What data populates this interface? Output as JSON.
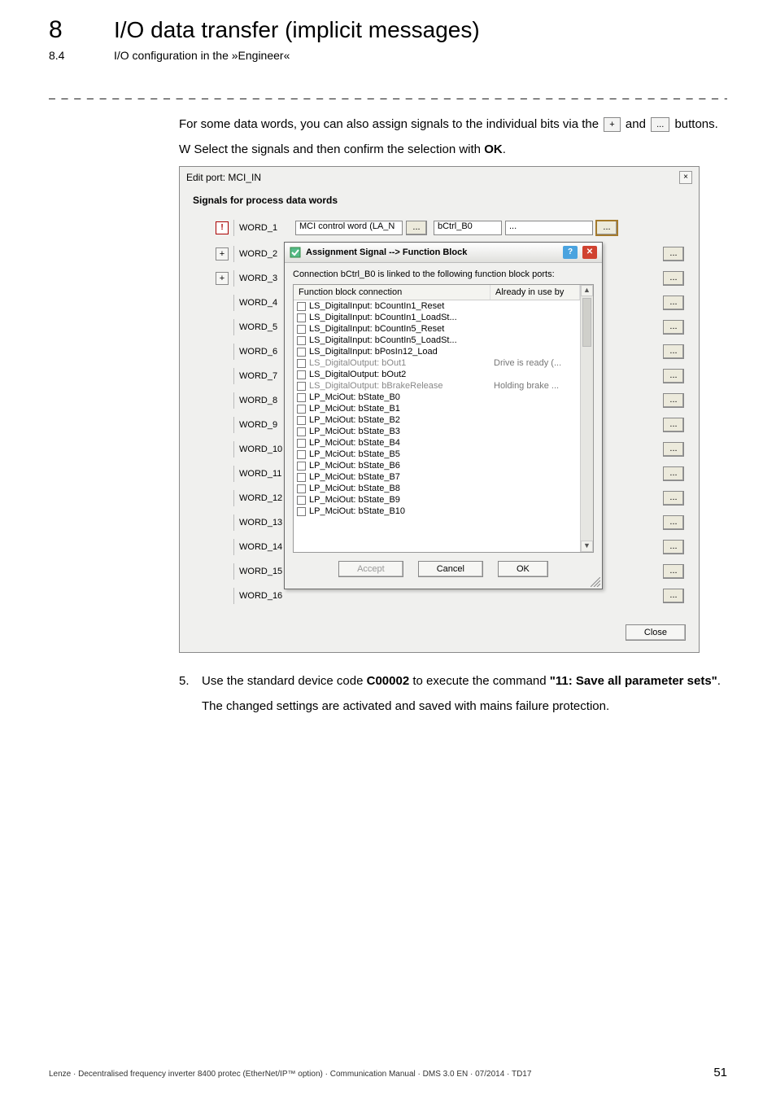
{
  "header": {
    "chapter_no": "8",
    "chapter_title": "I/O data transfer (implicit messages)",
    "section_no": "8.4",
    "section_title": "I/O configuration in the »Engineer«"
  },
  "intro": {
    "p1a": "For some data words, you can also assign signals to the individual bits via the ",
    "btn_plus": "+",
    "p1b": " and ",
    "btn_dots": "...",
    "p1c": " buttons.",
    "p2a": "W Select the signals and then confirm the selection with ",
    "p2b": "OK",
    "p2c": "."
  },
  "dialog": {
    "title": "Edit port: MCI_IN",
    "close_x": "×",
    "section": "Signals for process data words",
    "words": [
      {
        "label": "WORD_1",
        "left": "MCI control word (LA_N",
        "mid": "bCtrl_B0",
        "right": "..."
      },
      {
        "label": "WORD_2"
      },
      {
        "label": "WORD_3"
      },
      {
        "label": "WORD_4"
      },
      {
        "label": "WORD_5"
      },
      {
        "label": "WORD_6"
      },
      {
        "label": "WORD_7"
      },
      {
        "label": "WORD_8"
      },
      {
        "label": "WORD_9"
      },
      {
        "label": "WORD_10"
      },
      {
        "label": "WORD_11"
      },
      {
        "label": "WORD_12"
      },
      {
        "label": "WORD_13"
      },
      {
        "label": "WORD_14"
      },
      {
        "label": "WORD_15"
      },
      {
        "label": "WORD_16"
      }
    ],
    "close_btn": "Close"
  },
  "modal": {
    "title": "Assignment Signal --> Function Block",
    "desc": "Connection bCtrl_B0 is linked to the following function block ports:",
    "col1": "Function block connection",
    "col2": "Already in use by",
    "rows": [
      {
        "name": "LS_DigitalInput: bCountIn1_Reset",
        "use": "",
        "gray": false
      },
      {
        "name": "LS_DigitalInput: bCountIn1_LoadSt...",
        "use": "",
        "gray": false
      },
      {
        "name": "LS_DigitalInput: bCountIn5_Reset",
        "use": "",
        "gray": false
      },
      {
        "name": "LS_DigitalInput: bCountIn5_LoadSt...",
        "use": "",
        "gray": false
      },
      {
        "name": "LS_DigitalInput: bPosIn12_Load",
        "use": "",
        "gray": false
      },
      {
        "name": "LS_DigitalOutput: bOut1",
        "use": "Drive is ready (...",
        "gray": true
      },
      {
        "name": "LS_DigitalOutput: bOut2",
        "use": "",
        "gray": false
      },
      {
        "name": "LS_DigitalOutput: bBrakeRelease",
        "use": "Holding brake ...",
        "gray": true
      },
      {
        "name": "LP_MciOut: bState_B0",
        "use": "",
        "gray": false
      },
      {
        "name": "LP_MciOut: bState_B1",
        "use": "",
        "gray": false
      },
      {
        "name": "LP_MciOut: bState_B2",
        "use": "",
        "gray": false
      },
      {
        "name": "LP_MciOut: bState_B3",
        "use": "",
        "gray": false
      },
      {
        "name": "LP_MciOut: bState_B4",
        "use": "",
        "gray": false
      },
      {
        "name": "LP_MciOut: bState_B5",
        "use": "",
        "gray": false
      },
      {
        "name": "LP_MciOut: bState_B6",
        "use": "",
        "gray": false
      },
      {
        "name": "LP_MciOut: bState_B7",
        "use": "",
        "gray": false
      },
      {
        "name": "LP_MciOut: bState_B8",
        "use": "",
        "gray": false
      },
      {
        "name": "LP_MciOut: bState_B9",
        "use": "",
        "gray": false
      },
      {
        "name": "LP_MciOut: bState_B10",
        "use": "",
        "gray": false
      }
    ],
    "btn_accept": "Accept",
    "btn_cancel": "Cancel",
    "btn_ok": "OK"
  },
  "step5": {
    "num": "5.",
    "t1": "Use the standard device code ",
    "code": "C00002",
    "t2": " to execute the command ",
    "cmd": "\"11: Save all parameter sets\"",
    "t3": ".",
    "after": "The changed settings are activated and saved with mains failure protection."
  },
  "footer": {
    "left": "Lenze · Decentralised frequency inverter 8400 protec (EtherNet/IP™ option) · Communication Manual · DMS 3.0 EN · 07/2014 · TD17",
    "page": "51"
  },
  "sym": {
    "plus": "+",
    "dots": "...",
    "help": "?",
    "x": "✕",
    "up": "▲",
    "dn": "▼",
    "bang": "!"
  }
}
